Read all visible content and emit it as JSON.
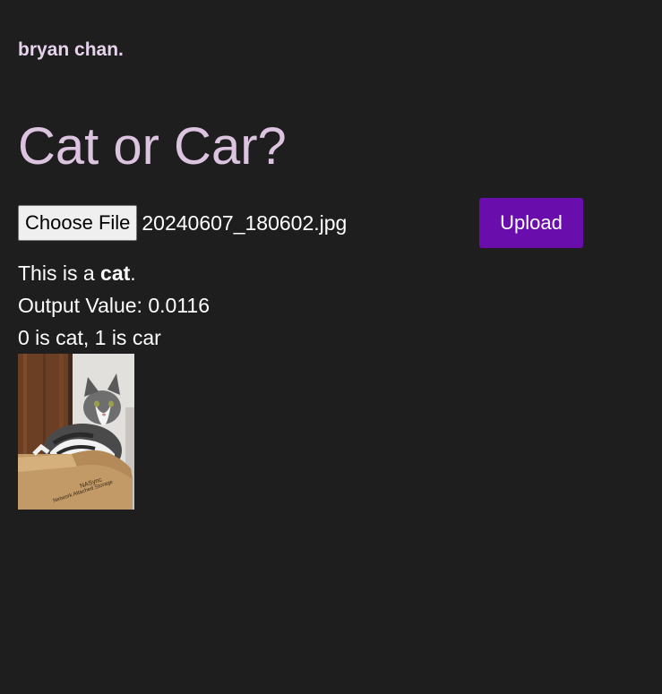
{
  "header": {
    "brand_name": "bryan chan",
    "brand_dot": "."
  },
  "main": {
    "title": "Cat or Car?",
    "file_input": {
      "button_label": "Choose File",
      "file_name": "20240607_180602.jpg"
    },
    "upload_label": "Upload",
    "result": {
      "prefix": "This is a ",
      "label": "cat",
      "suffix": ".",
      "output_label": "Output Value: ",
      "output_value": "0.0116",
      "legend": "0 is cat, 1 is car"
    },
    "image_subject": "cat-in-cardboard-box"
  },
  "colors": {
    "background": "#1e1e1e",
    "accent": "#6a0dad",
    "title": "#dcc3e0",
    "brand": "#e6d3ec"
  }
}
